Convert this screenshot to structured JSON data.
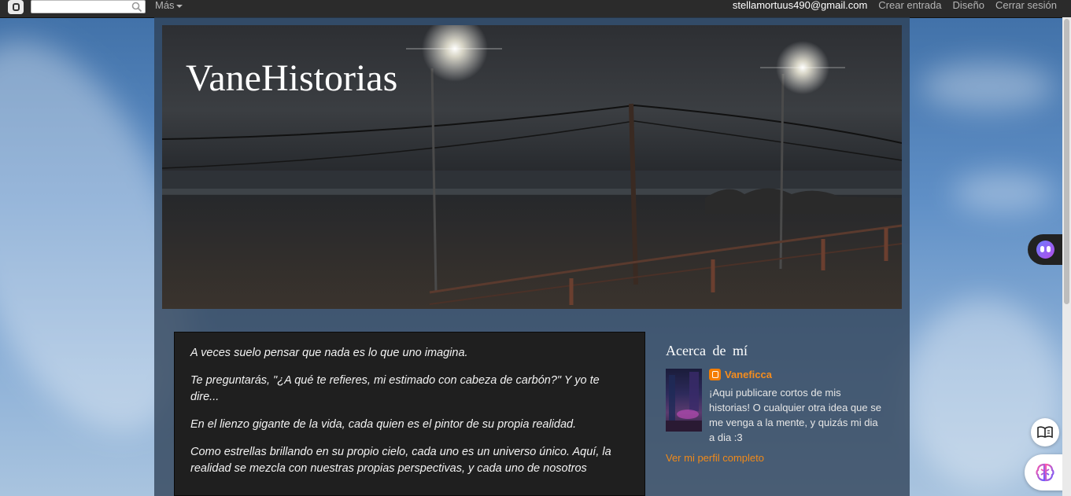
{
  "navbar": {
    "search_placeholder": "",
    "more_label": "Más",
    "email": "stellamortuus490@gmail.com",
    "create_post": "Crear entrada",
    "design": "Diseño",
    "sign_out": "Cerrar sesión"
  },
  "blog": {
    "title": "VaneHistorias"
  },
  "post": {
    "paragraphs": [
      " A veces suelo pensar que nada es lo que uno imagina.",
      "Te preguntarás, \"¿A qué te refieres, mi estimado con cabeza de carbón?\" Y yo te dire...",
      "En el lienzo gigante de la vida, cada quien es el pintor de su propia realidad.",
      "Como estrellas brillando en su propio cielo, cada uno es un universo único. Aquí, la realidad se mezcla con nuestras propias perspectivas, y cada uno de nosotros"
    ]
  },
  "sidebar": {
    "about_title": "Acerca de mí",
    "profile_name": "Vaneficca",
    "profile_description": "¡Aqui publicare cortos de mis historias! O cualquier otra idea que se me venga a la mente, y quizás mi dia a dia :3",
    "profile_link": "Ver mi perfil completo"
  },
  "icons": {
    "blogger_logo": "blogger-icon",
    "search": "search-icon",
    "reader": "book-open-icon",
    "brain": "brain-icon",
    "assistant": "assistant-face-icon"
  },
  "colors": {
    "navbar_bg": "#2b2b2b",
    "accent_link": "#f58d1e",
    "post_bg": "#1f1f1f"
  }
}
